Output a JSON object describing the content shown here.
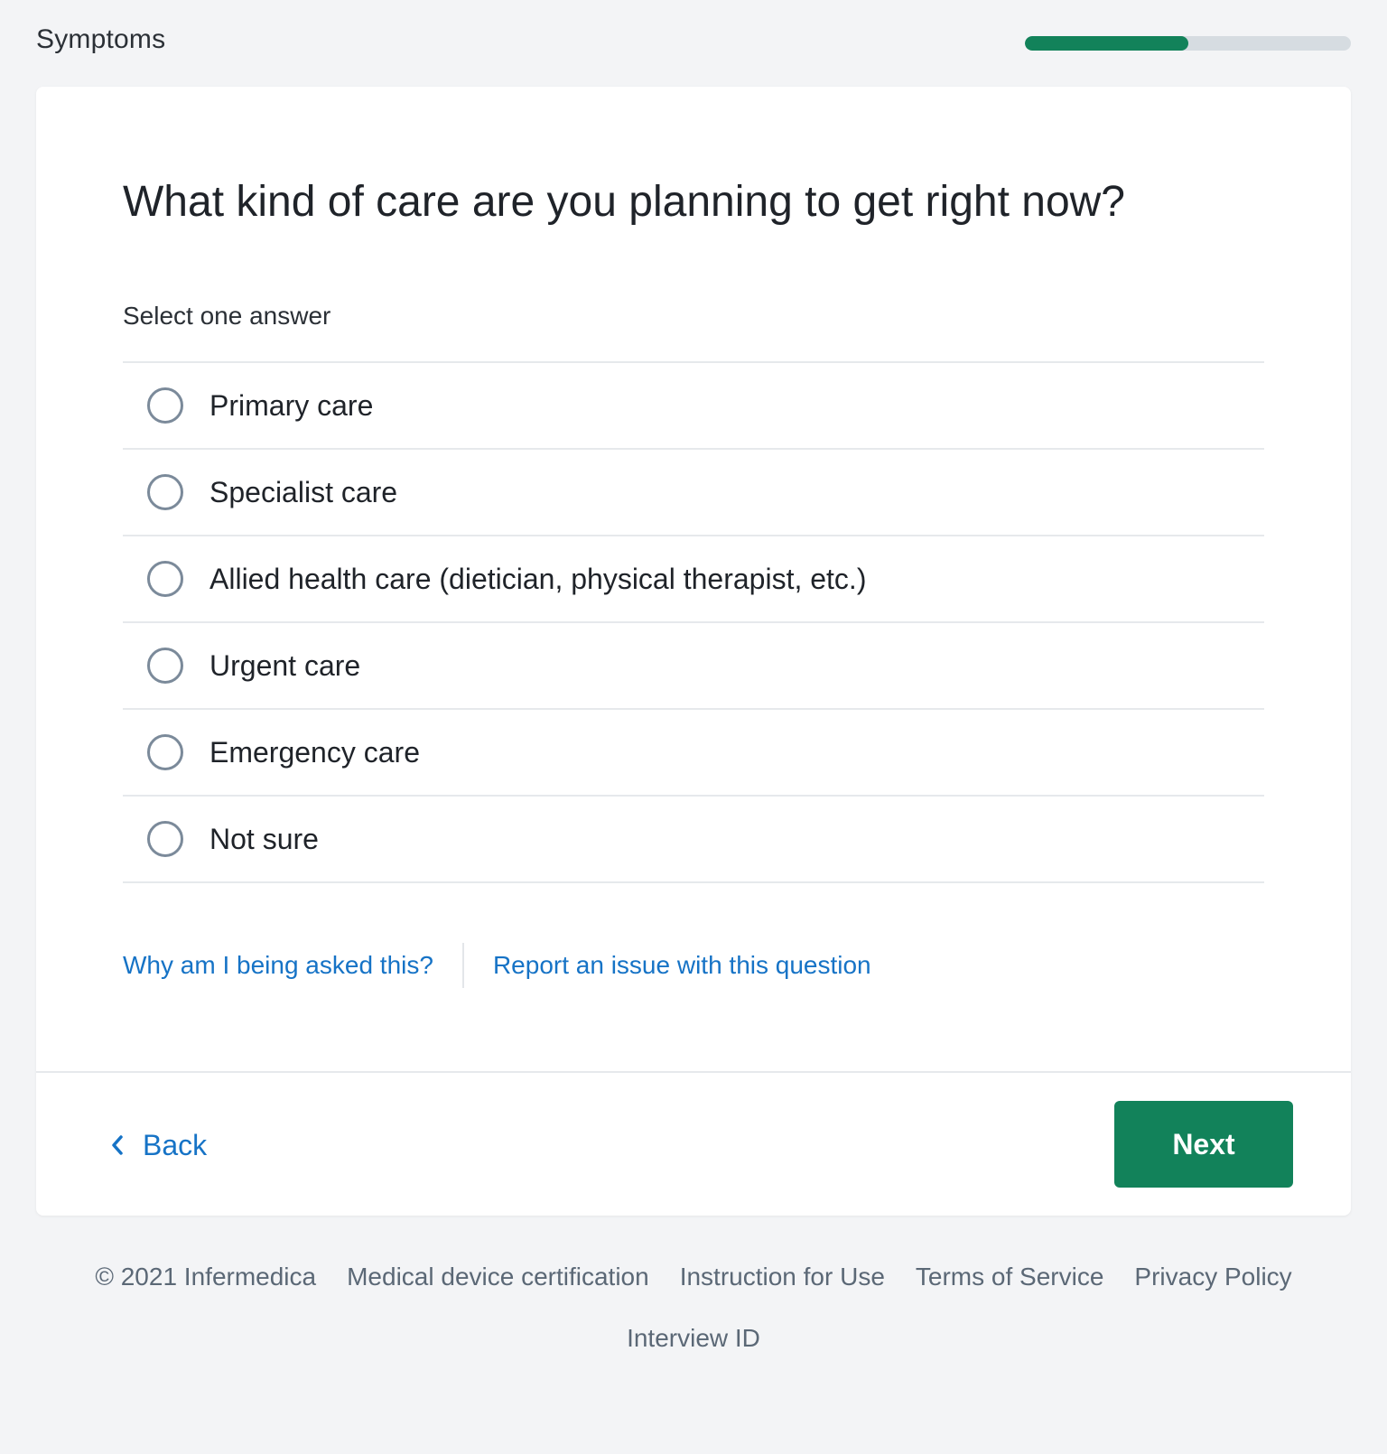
{
  "header": {
    "section_title": "Symptoms",
    "progress_fraction": 0.5
  },
  "question": {
    "title": "What kind of care are you planning to get right now?",
    "instructions": "Select one answer",
    "options": [
      {
        "label": "Primary care",
        "selected": false
      },
      {
        "label": "Specialist care",
        "selected": false
      },
      {
        "label": "Allied health care (dietician, physical therapist, etc.)",
        "selected": false
      },
      {
        "label": "Urgent care",
        "selected": false
      },
      {
        "label": "Emergency care",
        "selected": false
      },
      {
        "label": "Not sure",
        "selected": false
      }
    ]
  },
  "help": {
    "why_label": "Why am I being asked this?",
    "report_label": "Report an issue with this question"
  },
  "actions": {
    "back_label": "Back",
    "back_icon": "chevron-left-icon",
    "next_label": "Next"
  },
  "footer": {
    "copyright": "© 2021 Infermedica",
    "links": [
      "Medical device certification",
      "Instruction for Use",
      "Terms of Service",
      "Privacy Policy"
    ],
    "interview_id_label": "Interview ID"
  },
  "colors": {
    "accent_green": "#12825a",
    "link_blue": "#1673c6",
    "page_background": "#f3f4f6",
    "radio_border": "#7b8a9a",
    "footer_text": "#5b6876"
  }
}
